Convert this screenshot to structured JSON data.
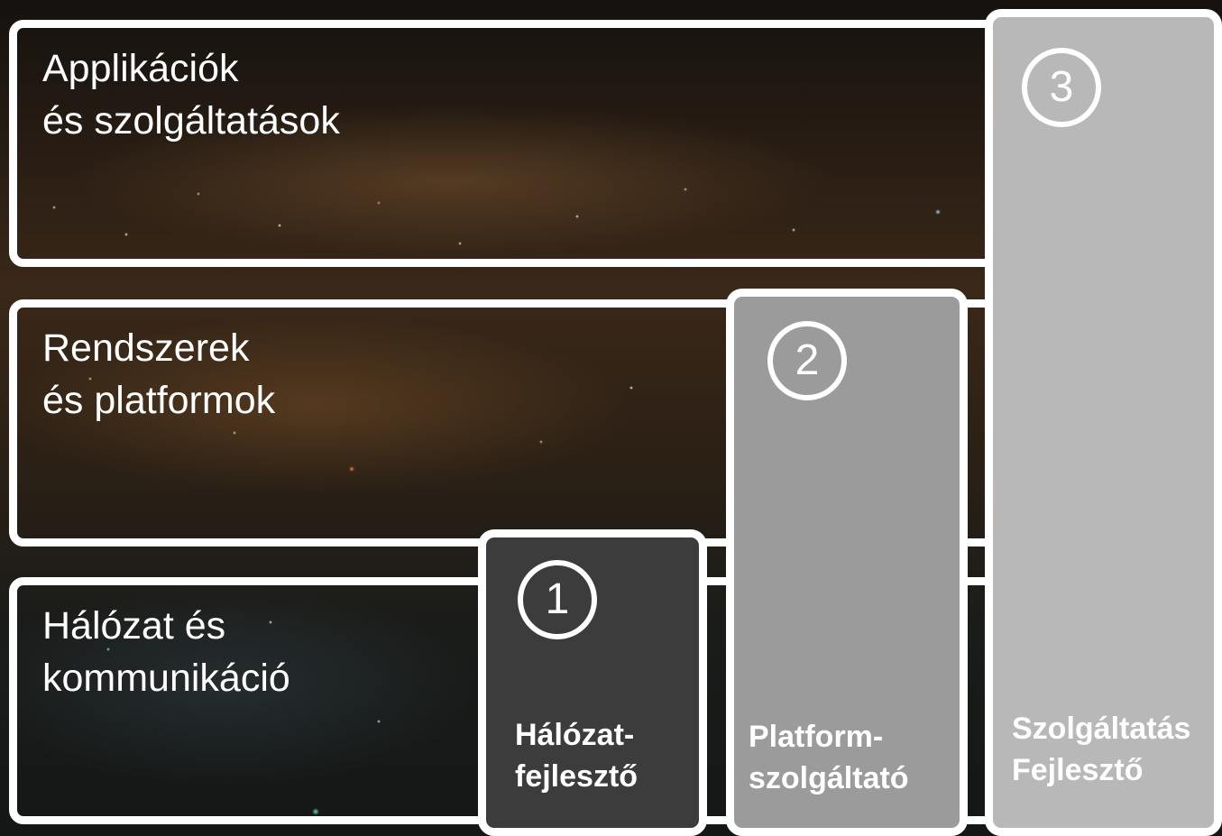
{
  "layers": [
    {
      "label": "Applikációk\nés szolgáltatások"
    },
    {
      "label": "Rendszerek\nés platformok"
    },
    {
      "label": "Hálózat és\nkommunikáció"
    }
  ],
  "roles": [
    {
      "number": "1",
      "label": "Hálózat-\nfejlesztő",
      "color": "#3c3c3c"
    },
    {
      "number": "2",
      "label": "Platform-\nszolgáltató",
      "color": "#9b9b9b"
    },
    {
      "number": "3",
      "label": "Szolgáltatás\nFejlesztő",
      "color": "#b8b8b8"
    }
  ]
}
